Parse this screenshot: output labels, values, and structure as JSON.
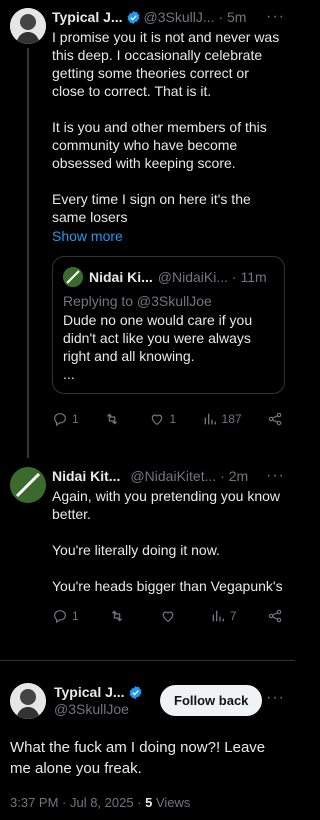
{
  "tweets": [
    {
      "name": "Typical J...",
      "handle": "@3SkullJ...",
      "time": "5m",
      "text": "I promise you it is not and never was this deep. I occasionally celebrate getting some theories correct or close to correct. That is it.\n\nIt is you and other members of this community who have become obsessed with keeping score.\n\nEvery time I sign on here it's the same losers",
      "show_more": "Show more",
      "quote": {
        "name": "Nidai Ki...",
        "handle": "@NidaiKi...",
        "time": "11m",
        "replying": "Replying to @3SkullJoe",
        "text": "Dude no one would care if you didn't act like you were always right and all knowing.\n..."
      },
      "stats": {
        "replies": "1",
        "retweets": "",
        "likes": "1",
        "views": "187"
      }
    },
    {
      "name": "Nidai Kit...",
      "handle": "@NidaiKitet...",
      "time": "2m",
      "text": "Again, with you pretending you know better.\n\nYou're literally doing it now.\n\nYou're heads bigger than Vegapunk's",
      "stats": {
        "replies": "1",
        "retweets": "",
        "likes": "",
        "views": "7"
      }
    }
  ],
  "main_post": {
    "name": "Typical J...",
    "handle": "@3SkullJoe",
    "follow_label": "Follow back",
    "text": "What the fuck am I doing now?! Leave me alone you freak.",
    "timestamp": "3:37 PM · Jul 8, 2025 · ",
    "views_count": "5",
    "views_label": "Views"
  },
  "colors": {
    "verified": "#1d9bf0",
    "muted": "#71767b",
    "link": "#1d9bf0"
  },
  "icons": [
    "reply-icon",
    "retweet-icon",
    "like-icon",
    "views-icon",
    "share-icon",
    "verified-icon",
    "more-icon"
  ]
}
